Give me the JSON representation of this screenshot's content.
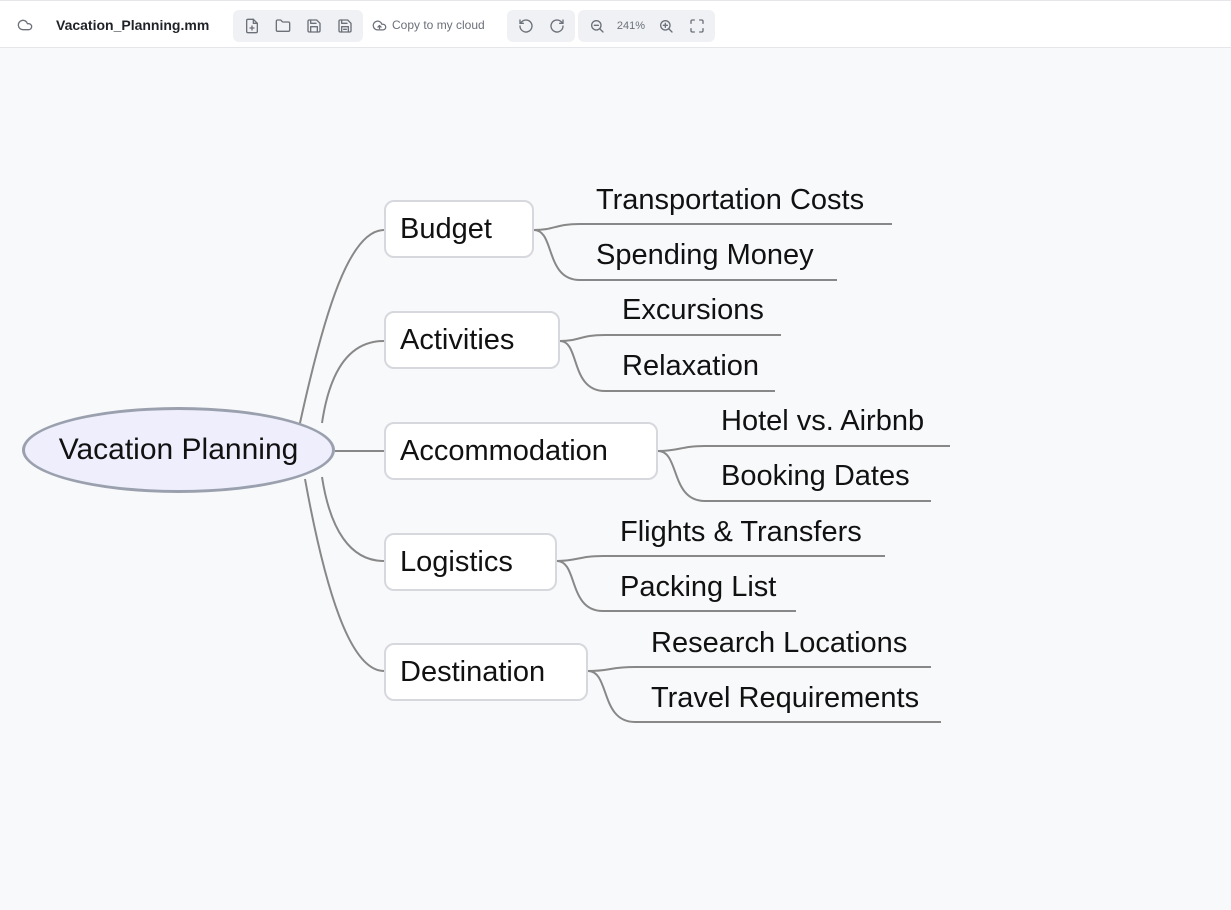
{
  "header": {
    "file_name": "Vacation_Planning.mm",
    "copy_to_cloud_label": "Copy to my cloud",
    "zoom_level": "241%",
    "icons": [
      "cloud-icon",
      "new-file-icon",
      "folder-open-icon",
      "save-icon",
      "save-as-icon",
      "cloud-upload-icon",
      "undo-icon",
      "redo-icon",
      "zoom-out-icon",
      "zoom-in-icon",
      "fullscreen-icon"
    ]
  },
  "mindmap": {
    "root": "Vacation Planning",
    "branches": [
      {
        "label": "Budget",
        "children": [
          "Transportation Costs",
          "Spending Money"
        ]
      },
      {
        "label": "Activities",
        "children": [
          "Excursions",
          "Relaxation"
        ]
      },
      {
        "label": "Accommodation",
        "children": [
          "Hotel vs. Airbnb",
          "Booking Dates"
        ]
      },
      {
        "label": "Logistics",
        "children": [
          "Flights & Transfers",
          "Packing List"
        ]
      },
      {
        "label": "Destination",
        "children": [
          "Research Locations",
          "Travel Requirements"
        ]
      }
    ]
  },
  "colors": {
    "root_fill": "#eeeefc",
    "root_border": "#9aa0ad",
    "branch_border": "#d6d8dd",
    "link": "#888888",
    "toolbar_bg": "#ffffff",
    "canvas_bg": "#f8f9fb"
  }
}
